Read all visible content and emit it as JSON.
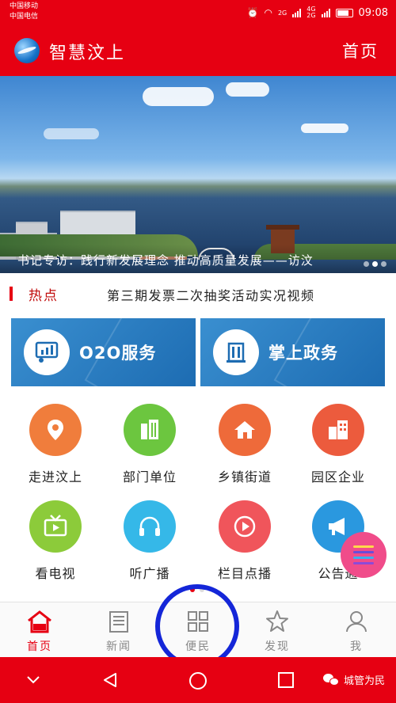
{
  "status": {
    "carrier1": "中国移动",
    "carrier2": "中国电信",
    "net1": "2G",
    "net2": "4G",
    "net3": "2G",
    "time": "09:08"
  },
  "header": {
    "title": "智慧汶上",
    "home": "首页"
  },
  "banner": {
    "caption": "书记专访：践行新发展理念 推动高质量发展——访汶",
    "slides": 3,
    "active_slide": 2
  },
  "hot": {
    "label": "热点",
    "headline": "第三期发票二次抽奖活动实况视频"
  },
  "services": [
    {
      "label": "O2O服务",
      "icon": "presentation-icon"
    },
    {
      "label": "掌上政务",
      "icon": "building-icon"
    }
  ],
  "grid": [
    {
      "label": "走进汶上",
      "icon": "map-pin-icon",
      "color": "#f07d3c"
    },
    {
      "label": "部门单位",
      "icon": "office-tower-icon",
      "color": "#6cc63f"
    },
    {
      "label": "乡镇街道",
      "icon": "house-icon",
      "color": "#ee6a3a"
    },
    {
      "label": "园区企业",
      "icon": "factory-icon",
      "color": "#ec5b3d"
    },
    {
      "label": "看电视",
      "icon": "tv-icon",
      "color": "#8ccb3a"
    },
    {
      "label": "听广播",
      "icon": "headphones-icon",
      "color": "#35b8e8"
    },
    {
      "label": "栏目点播",
      "icon": "play-icon",
      "color": "#f0555b"
    },
    {
      "label": "公告通",
      "icon": "megaphone-icon",
      "color": "#2a98df"
    }
  ],
  "tabs": [
    {
      "label": "首页",
      "icon": "home-icon",
      "active": true
    },
    {
      "label": "新闻",
      "icon": "newspaper-icon",
      "active": false
    },
    {
      "label": "便民",
      "icon": "grid-icon",
      "active": false
    },
    {
      "label": "发现",
      "icon": "star-icon",
      "active": false
    },
    {
      "label": "我",
      "icon": "person-icon",
      "active": false
    }
  ],
  "colors": {
    "brand": "#e60012",
    "ring": "#1426d8",
    "fab": "#f04c8a"
  },
  "watermark": "城管为民"
}
